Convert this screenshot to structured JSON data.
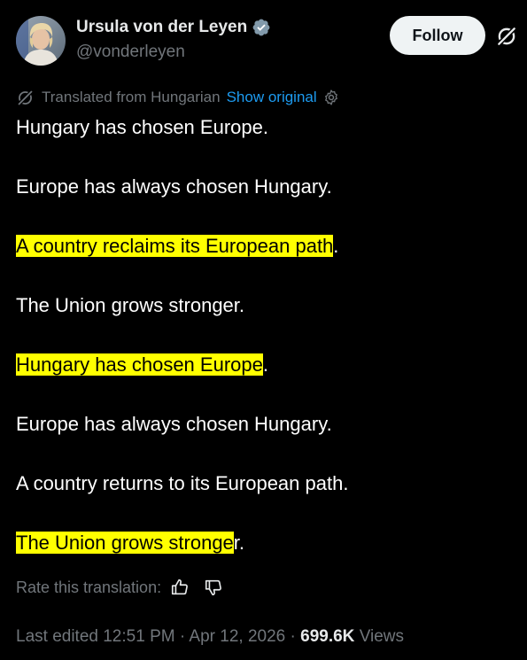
{
  "author": {
    "display_name": "Ursula von der Leyen",
    "handle": "@vonderleyen",
    "avatar_icon": "user-avatar-photo",
    "verified_icon": "verified-badge-icon"
  },
  "actions": {
    "follow_label": "Follow",
    "grok_icon": "grok-icon"
  },
  "translation": {
    "label": "Translated from Hungarian",
    "show_original": "Show original",
    "settings_icon": "gear-icon"
  },
  "post": {
    "lines": [
      {
        "highlighted": "",
        "plain": "Hungary has chosen Europe."
      },
      {
        "highlighted": "",
        "plain": "Europe has always chosen Hungary."
      },
      {
        "highlighted": "A country reclaims its European path",
        "plain": "."
      },
      {
        "highlighted": "",
        "plain": "The Union grows stronger."
      },
      {
        "highlighted": "Hungary has chosen Europe",
        "plain": "."
      },
      {
        "highlighted": "",
        "plain": "Europe has always chosen Hungary."
      },
      {
        "highlighted": "",
        "plain": "A country returns to its European path."
      },
      {
        "highlighted": "The Union grows stronge",
        "plain": "r."
      }
    ],
    "highlight_color": "#ffff00"
  },
  "rating": {
    "label": "Rate this translation:",
    "thumbs_up_icon": "thumbs-up-icon",
    "thumbs_down_icon": "thumbs-down-icon"
  },
  "meta": {
    "edited": "Last edited 12:51 PM",
    "separator": " · ",
    "date": "Apr 12, 2026",
    "views_count": "699.6K",
    "views_label": "Views"
  },
  "colors": {
    "background": "#000000",
    "text": "#e7e9ea",
    "muted": "#71767b",
    "link": "#1d9bf0",
    "verified": "#829aab",
    "follow_bg": "#eff3f4"
  }
}
